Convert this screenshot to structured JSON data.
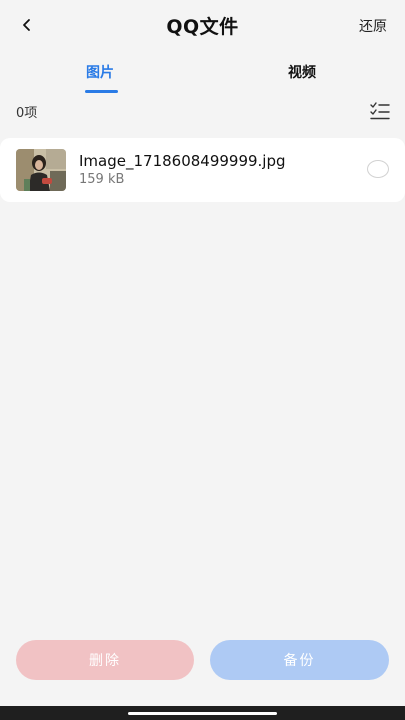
{
  "header": {
    "back_icon": "chevron-left-icon",
    "title": "QQ文件",
    "restore_label": "还原"
  },
  "tabs": [
    {
      "label": "图片",
      "active": true
    },
    {
      "label": "视频",
      "active": false
    }
  ],
  "selection": {
    "count_label": "0项",
    "select_all_icon": "checklist-icon"
  },
  "files": [
    {
      "name": "Image_1718608499999.jpg",
      "size": "159 kB",
      "thumbnail_icon": "photo-thumbnail",
      "selected": false
    }
  ],
  "actions": {
    "delete_label": "删除",
    "backup_label": "备份"
  },
  "colors": {
    "accent": "#2a7be6",
    "delete_button": "#f1c2c4",
    "backup_button": "#aecaf4",
    "background": "#f4f4f4"
  }
}
